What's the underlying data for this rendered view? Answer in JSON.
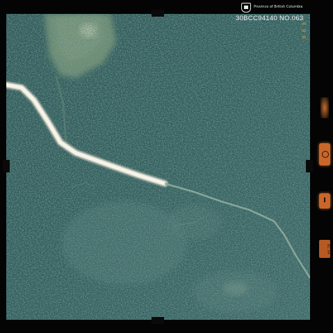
{
  "header": {
    "province": "Province of British Columbia",
    "photo_id": "30BCC94140 NO.063"
  },
  "edge_code": "0 6 3",
  "side_code": "BC 94",
  "colors": {
    "forest_dark": "#1b3a3c",
    "forest_mid": "#3f6a66",
    "clearing": "#6f8a6a",
    "road": "#f3f1e6",
    "film_orange": "#c9672a"
  }
}
